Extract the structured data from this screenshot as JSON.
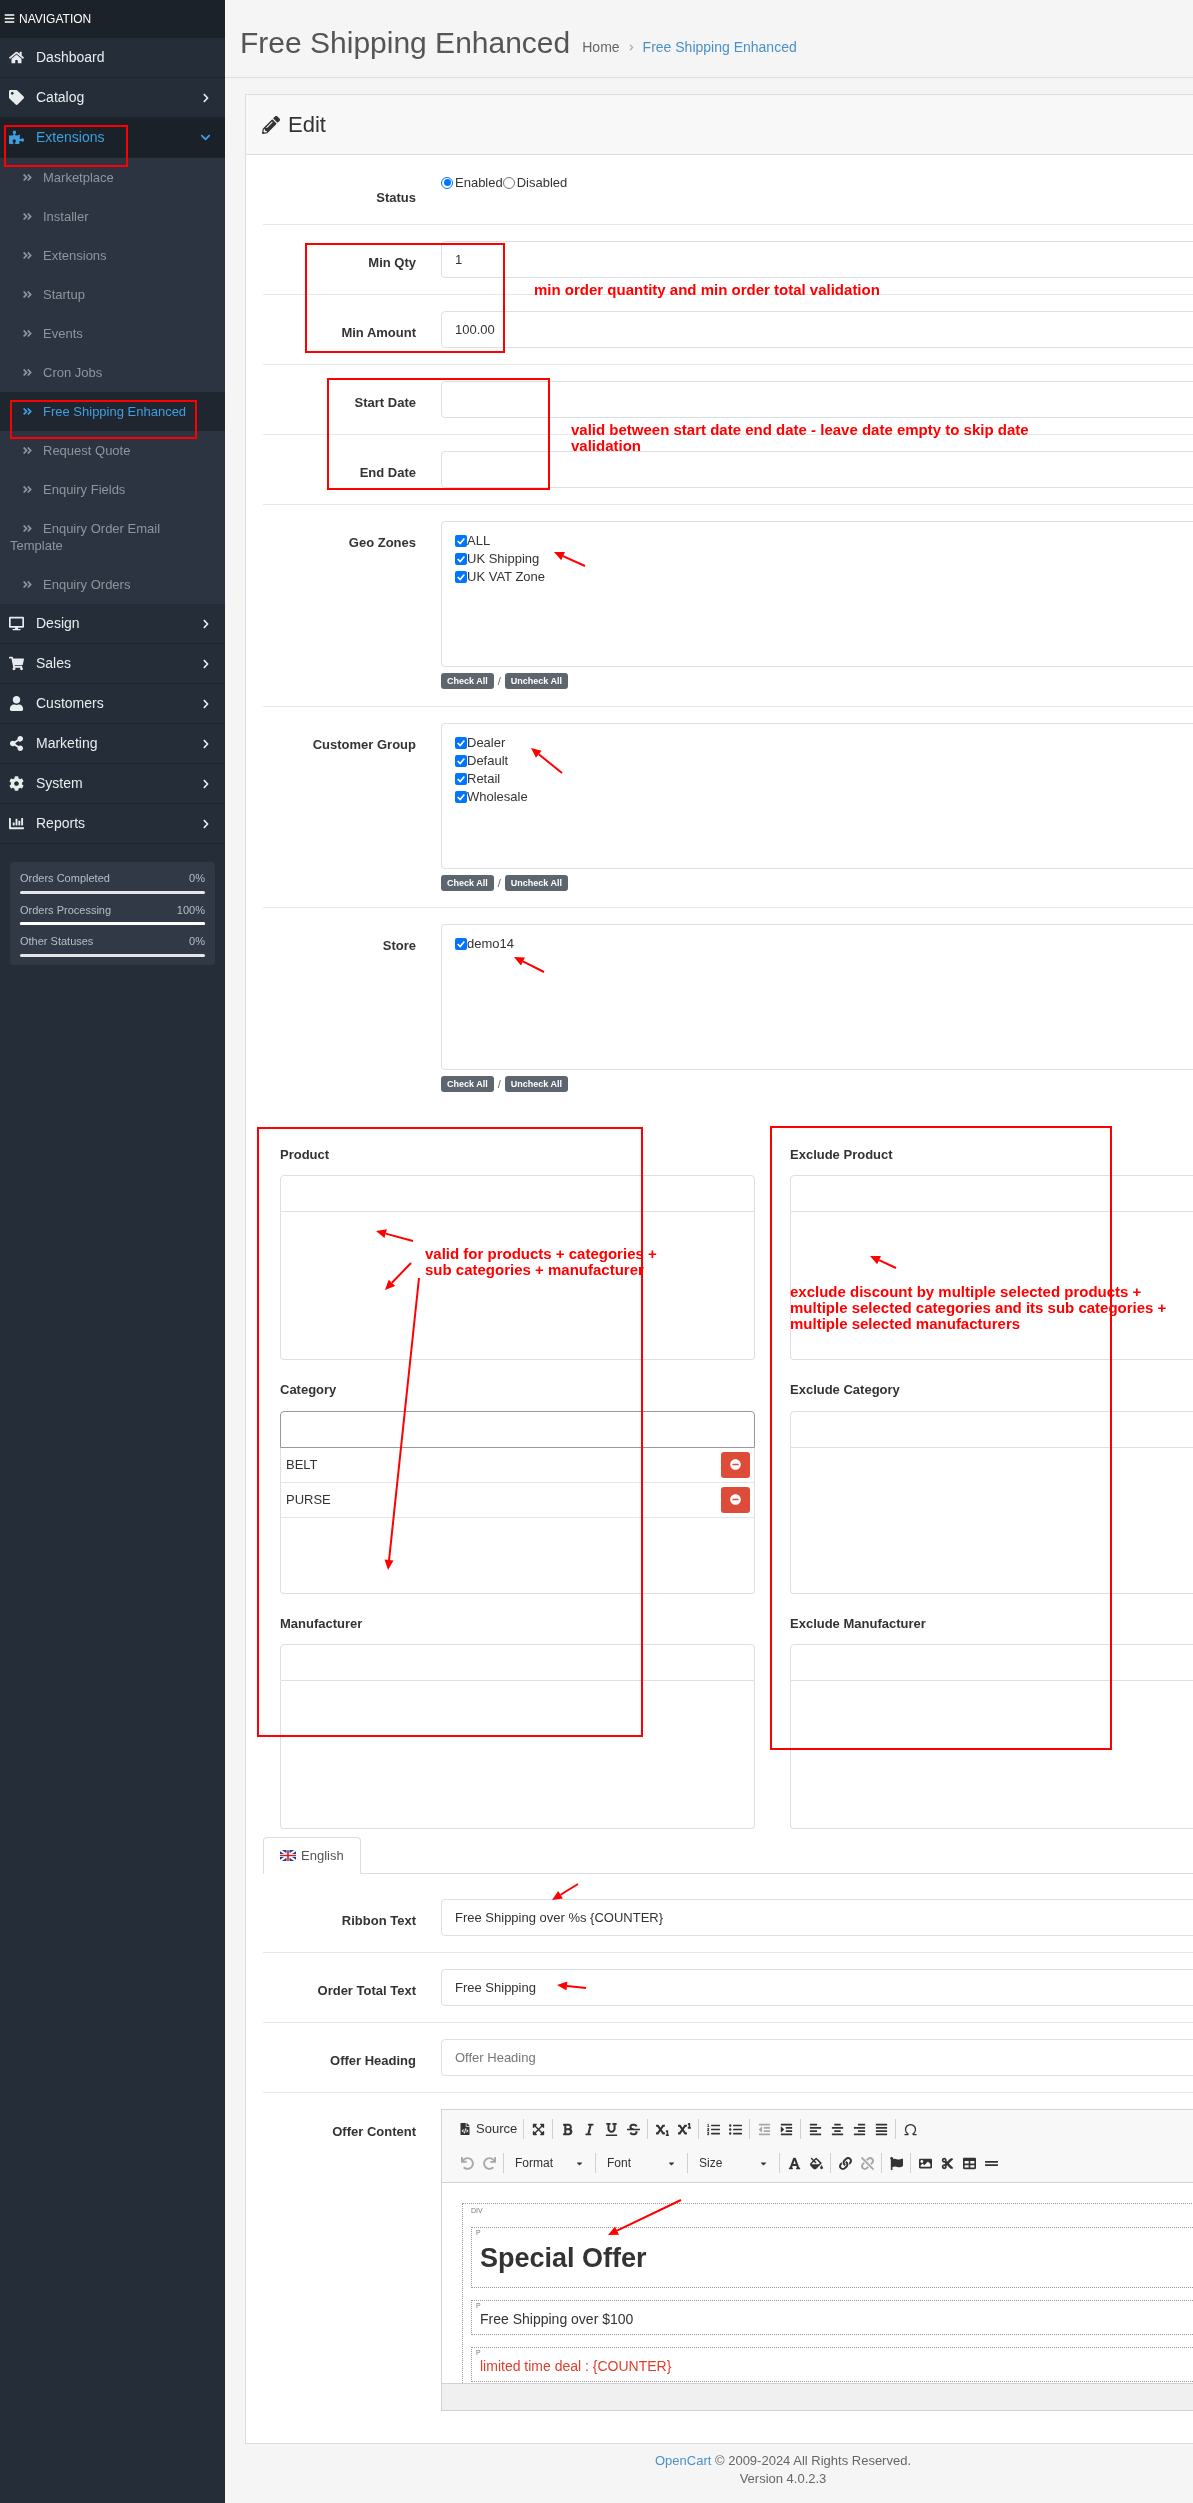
{
  "sidebar": {
    "header": "NAVIGATION",
    "items": [
      {
        "label": "Dashboard",
        "has_children": false,
        "expanded": false
      },
      {
        "label": "Catalog",
        "has_children": true,
        "expanded": false
      },
      {
        "label": "Extensions",
        "has_children": true,
        "expanded": true,
        "children": [
          {
            "label": "Marketplace",
            "selected": false
          },
          {
            "label": "Installer",
            "selected": false
          },
          {
            "label": "Extensions",
            "selected": false
          },
          {
            "label": "Startup",
            "selected": false
          },
          {
            "label": "Events",
            "selected": false
          },
          {
            "label": "Cron Jobs",
            "selected": false
          },
          {
            "label": "Free Shipping Enhanced",
            "selected": true
          },
          {
            "label": "Request Quote",
            "selected": false
          },
          {
            "label": "Enquiry Fields",
            "selected": false
          },
          {
            "label": "Enquiry Order Email Template",
            "selected": false
          },
          {
            "label": "Enquiry Orders",
            "selected": false
          }
        ]
      },
      {
        "label": "Design",
        "has_children": true,
        "expanded": false
      },
      {
        "label": "Sales",
        "has_children": true,
        "expanded": false
      },
      {
        "label": "Customers",
        "has_children": true,
        "expanded": false
      },
      {
        "label": "Marketing",
        "has_children": true,
        "expanded": false
      },
      {
        "label": "System",
        "has_children": true,
        "expanded": false
      },
      {
        "label": "Reports",
        "has_children": true,
        "expanded": false
      }
    ],
    "stats": [
      {
        "label": "Orders Completed",
        "value": "0%",
        "level": 0
      },
      {
        "label": "Orders Processing",
        "value": "100%",
        "level": 1
      },
      {
        "label": "Other Statuses",
        "value": "0%",
        "level": 0
      }
    ]
  },
  "header": {
    "title": "Free Shipping Enhanced",
    "breadcrumbs": [
      {
        "label": "Home",
        "selected": false
      },
      {
        "label": "Free Shipping Enhanced",
        "selected": true
      }
    ]
  },
  "panel": {
    "title": "Edit",
    "status": {
      "label": "Status",
      "options": [
        {
          "label": "Enabled",
          "selected": true
        },
        {
          "label": "Disabled",
          "selected": false
        }
      ]
    },
    "min_qty": {
      "label": "Min Qty",
      "value": "1"
    },
    "min_amount": {
      "label": "Min Amount",
      "value": "100.00"
    },
    "start_date": {
      "label": "Start Date"
    },
    "end_date": {
      "label": "End Date"
    },
    "checklists": [
      {
        "label": "Geo Zones",
        "items": [
          {
            "label": "ALL",
            "checked": true
          },
          {
            "label": "UK Shipping",
            "checked": true
          },
          {
            "label": "UK VAT Zone",
            "checked": true
          }
        ],
        "buttons": [
          "Check All",
          "Uncheck All"
        ],
        "separator": "/"
      },
      {
        "label": "Customer Group",
        "items": [
          {
            "label": "Dealer",
            "checked": true
          },
          {
            "label": "Default",
            "checked": true
          },
          {
            "label": "Retail",
            "checked": true
          },
          {
            "label": "Wholesale",
            "checked": true
          }
        ],
        "buttons": [
          "Check All",
          "Uncheck All"
        ],
        "separator": "/"
      },
      {
        "label": "Store",
        "items": [
          {
            "label": "demo14",
            "checked": true
          }
        ],
        "buttons": [
          "Check All",
          "Uncheck All"
        ],
        "separator": "/"
      }
    ],
    "include": [
      {
        "label": "Product"
      },
      {
        "label": "Category",
        "items": [
          {
            "label": "BELT"
          },
          {
            "label": "PURSE"
          }
        ]
      },
      {
        "label": "Manufacturer"
      }
    ],
    "exclude": [
      {
        "label": "Exclude Product"
      },
      {
        "label": "Exclude Category"
      },
      {
        "label": "Exclude Manufacturer"
      }
    ],
    "language_tab": {
      "label": "English",
      "selected": true
    },
    "ribbon_text": {
      "label": "Ribbon Text",
      "value": "Free Shipping over %s {COUNTER}"
    },
    "order_total_text": {
      "label": "Order Total Text",
      "value": "Free Shipping"
    },
    "offer_heading": {
      "label": "Offer Heading",
      "placeholder": "Offer Heading"
    },
    "offer_content": {
      "label": "Offer Content",
      "source_label": "Source",
      "dropdowns": [
        "Format",
        "Font",
        "Size"
      ],
      "block_tag": "DIV",
      "paragraphs": [
        {
          "tag": "P",
          "text": "Special Offer",
          "kind": "heading"
        },
        {
          "tag": "P",
          "text": "Free Shipping over $100",
          "kind": "plain"
        },
        {
          "tag": "P",
          "text": "limited time deal : {COUNTER}",
          "kind": "highlight"
        }
      ]
    }
  },
  "footer": {
    "link": "OpenCart",
    "text": "© 2009-2024 All Rights Reserved.",
    "version": "Version 4.0.2.3"
  },
  "annotations": [
    {
      "text": "min order quantity and min order total validation"
    },
    {
      "text": "valid between start date end date - leave date empty to skip date validation"
    },
    {
      "text": "valid for products + categories + sub categories + manufacturer"
    },
    {
      "text": "exclude discount by multiple selected products + multiple selected categories and its sub categories + multiple selected manufacturers"
    }
  ]
}
